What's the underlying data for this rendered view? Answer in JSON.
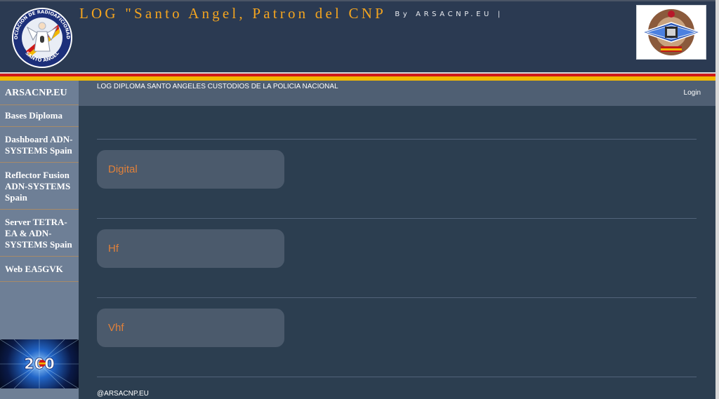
{
  "header": {
    "title": "LOG \"Santo Angel, Patron del CNP",
    "byline": "By ARSACNP.EU |",
    "logo_left_text": "ASOCIACIÓN DE RADIOAFICIONADOS SANTO ANGEL",
    "colors": {
      "title": "#f3a41f",
      "background": "#2b3a52"
    }
  },
  "sidebar": {
    "items": [
      {
        "label": "ARSACNP.EU"
      },
      {
        "label": "Bases Diploma"
      },
      {
        "label": "Dashboard ADN-SYSTEMS Spain"
      },
      {
        "label": "Reflector Fusion ADN-SYSTEMS Spain"
      },
      {
        "label": "Server TETRA-EA & ADN-SYSTEMS Spain"
      },
      {
        "label": "Web EA5GVK"
      }
    ],
    "banner_text": "200"
  },
  "topbar": {
    "page_title": "LOG DIPLOMA SANTO ANGELES CUSTODIOS DE LA POLICIA NACIONAL",
    "login": "Login"
  },
  "cards": [
    {
      "label": "Digital"
    },
    {
      "label": "Hf"
    },
    {
      "label": "Vhf"
    }
  ],
  "footer": {
    "text": "@ARSACNP.EU"
  },
  "colors": {
    "accent": "#e0803a",
    "sidebar": "#6e7f96",
    "content_bg": "#2c3e50"
  }
}
